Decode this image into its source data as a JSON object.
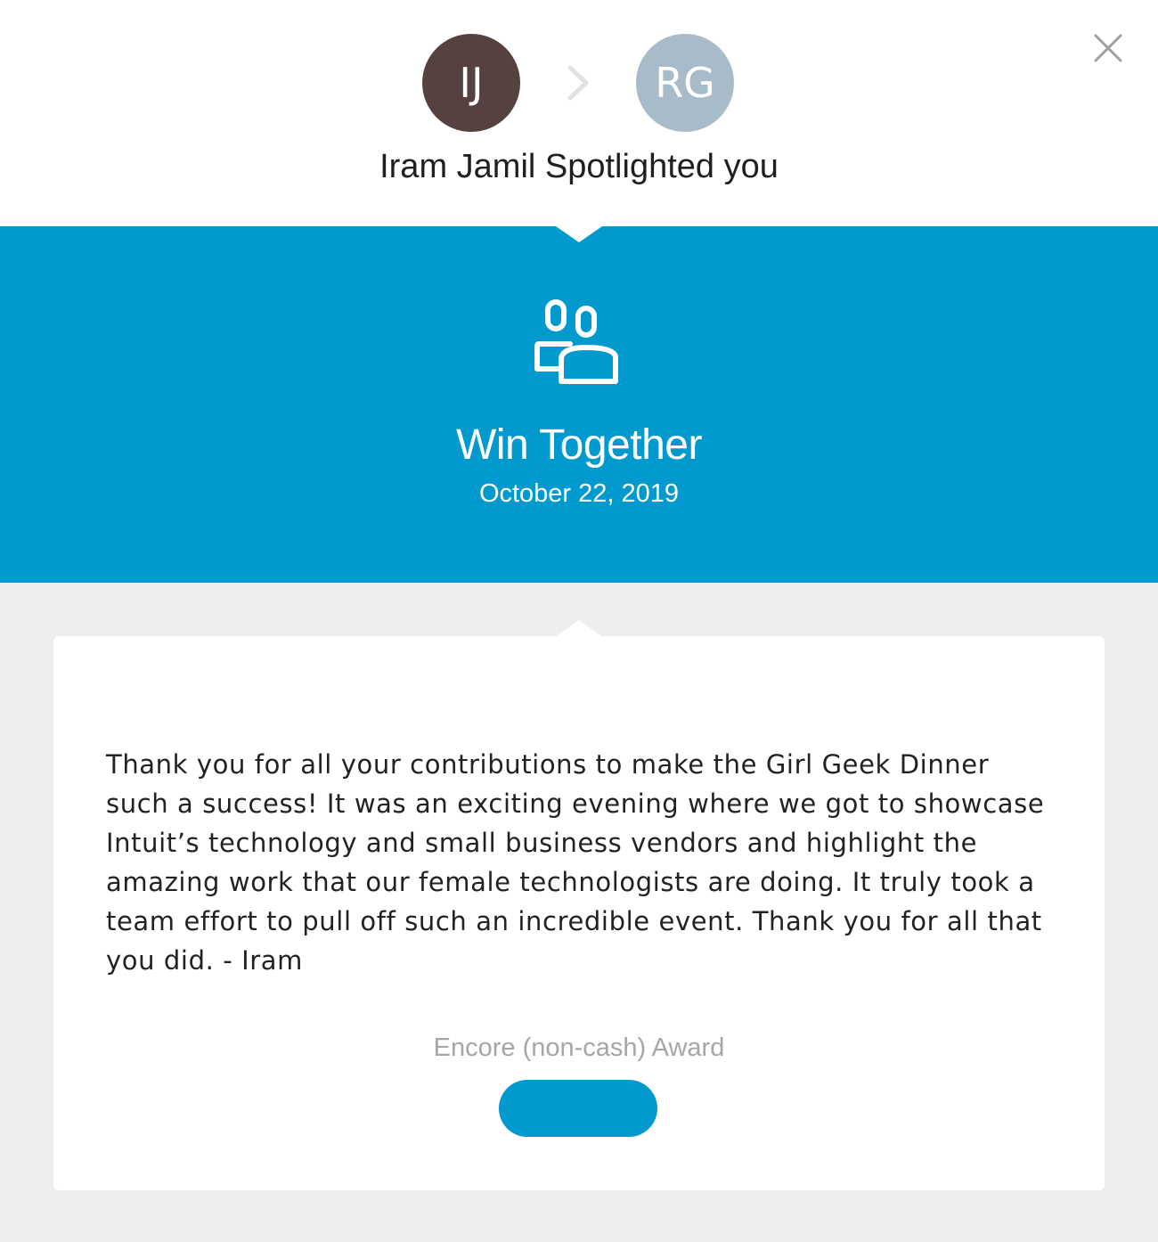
{
  "header": {
    "sender": {
      "initials": "IJ",
      "name": "Iram Jamil",
      "color": "#55413f"
    },
    "recipient": {
      "initials": "RG",
      "color": "#a7bbc8"
    },
    "action_text": "Spotlighted",
    "target_text": "you",
    "close_icon": "close-icon",
    "arrow_icon": "chevron-right-icon"
  },
  "award": {
    "icon": "team-people-icon",
    "title": "Win Together",
    "date": "October 22, 2019",
    "accent_color": "#0299cf"
  },
  "message": {
    "body": "Thank you for all your contributions to make the Girl Geek Dinner such a success! It was an exciting evening where we got to showcase Intuit’s technology and small business vendors and highlight the amazing work that our female technologists are doing. It truly took a team effort to pull off such an incredible event. Thank you for all that you did. - Iram"
  },
  "award_details": {
    "type_label": "Encore (non-cash) Award",
    "button_label": ""
  }
}
